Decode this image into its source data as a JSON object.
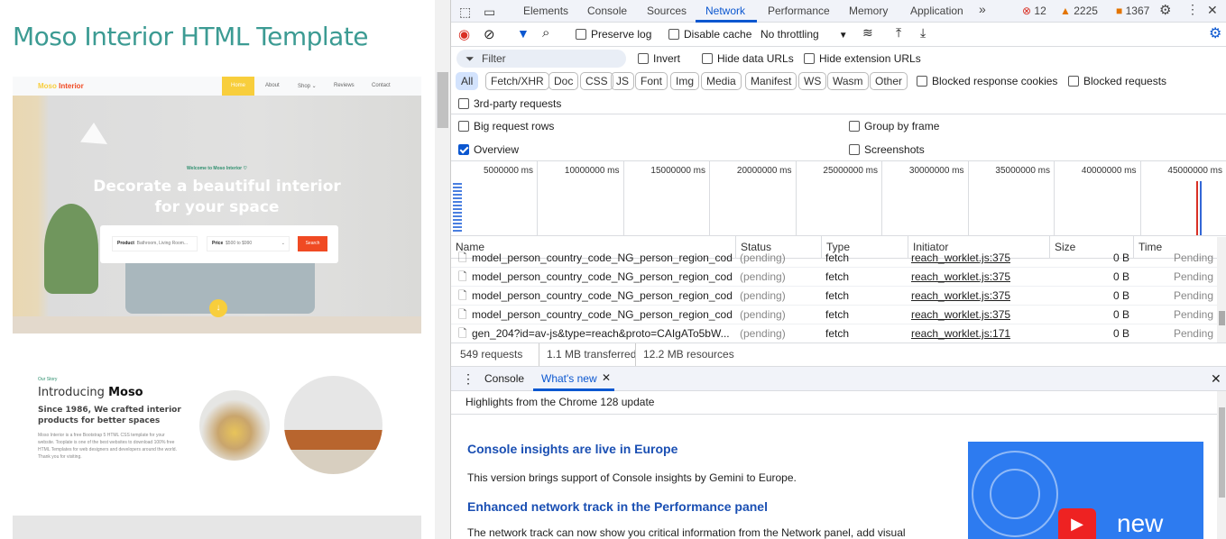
{
  "page": {
    "title": "Moso Interior HTML Template",
    "nav": {
      "logo_a": "Moso",
      "logo_b": "Interior",
      "items": [
        "Home",
        "About",
        "Shop ⌄",
        "Reviews",
        "Contact"
      ]
    },
    "hero": {
      "welcome": "Welcome to Moso Interior ♡",
      "headline_1": "Decorate a beautiful interior",
      "headline_2": "for your space",
      "product_label": "Product",
      "product_placeholder": "Bathroom, Living Room...",
      "price_label": "Price",
      "price_value": "$500 to $990",
      "search": "Search"
    },
    "story": {
      "tag": "Our Story",
      "title_a": "Introducing",
      "title_b": "Moso",
      "subtitle": "Since 1986, We crafted interior products for better spaces",
      "body": "Moso Interior is a free Bootstrap 5 HTML CSS template for your website. Tooplate is one of the best websites to download 100% free HTML Templates for web designers and developers around the world. Thank you for visiting."
    }
  },
  "devtools": {
    "tabs": [
      "Elements",
      "Console",
      "Sources",
      "Network",
      "Performance",
      "Memory",
      "Application"
    ],
    "more": "»",
    "errors": "12",
    "warnings": "2225",
    "issues": "1367",
    "toolbar": {
      "preserve_log": "Preserve log",
      "disable_cache": "Disable cache",
      "throttling": "No throttling"
    },
    "filter": {
      "placeholder": "Filter",
      "invert": "Invert",
      "hide_data": "Hide data URLs",
      "hide_ext": "Hide extension URLs"
    },
    "types": [
      "All",
      "Fetch/XHR",
      "Doc",
      "CSS",
      "JS",
      "Font",
      "Img",
      "Media",
      "Manifest",
      "WS",
      "Wasm",
      "Other"
    ],
    "blocked_cookies": "Blocked response cookies",
    "blocked_requests": "Blocked requests",
    "third_party": "3rd-party requests",
    "options": {
      "big_rows": "Big request rows",
      "group_frame": "Group by frame",
      "overview": "Overview",
      "screenshots": "Screenshots"
    },
    "overview_ticks": [
      "5000000 ms",
      "10000000 ms",
      "15000000 ms",
      "20000000 ms",
      "25000000 ms",
      "30000000 ms",
      "35000000 ms",
      "40000000 ms",
      "45000000 ms"
    ],
    "columns": [
      "Name",
      "Status",
      "Type",
      "Initiator",
      "Size",
      "Time"
    ],
    "rows": [
      {
        "name": "model_person_country_code_NG_person_region_cod...",
        "status": "(pending)",
        "type": "fetch",
        "initiator": "reach_worklet.js:375",
        "size": "0 B",
        "time": "Pending"
      },
      {
        "name": "model_person_country_code_NG_person_region_cod...",
        "status": "(pending)",
        "type": "fetch",
        "initiator": "reach_worklet.js:375",
        "size": "0 B",
        "time": "Pending"
      },
      {
        "name": "model_person_country_code_NG_person_region_cod...",
        "status": "(pending)",
        "type": "fetch",
        "initiator": "reach_worklet.js:375",
        "size": "0 B",
        "time": "Pending"
      },
      {
        "name": "model_person_country_code_NG_person_region_cod...",
        "status": "(pending)",
        "type": "fetch",
        "initiator": "reach_worklet.js:375",
        "size": "0 B",
        "time": "Pending"
      },
      {
        "name": "gen_204?id=av-js&type=reach&proto=CAIgATo5bW...",
        "status": "(pending)",
        "type": "fetch",
        "initiator": "reach_worklet.js:171",
        "size": "0 B",
        "time": "Pending"
      }
    ],
    "summary": {
      "requests": "549 requests",
      "transferred": "1.1 MB transferred",
      "resources": "12.2 MB resources"
    },
    "drawer": {
      "console": "Console",
      "whats_new": "What's new",
      "highlights": "Highlights from the Chrome 128 update",
      "h1": "Console insights are live in Europe",
      "p1": "This version brings support of Console insights by Gemini to Europe.",
      "h2": "Enhanced network track in the Performance panel",
      "p2": "The network track can now show you critical information from the Network panel, add visual",
      "video_label": "new"
    }
  }
}
